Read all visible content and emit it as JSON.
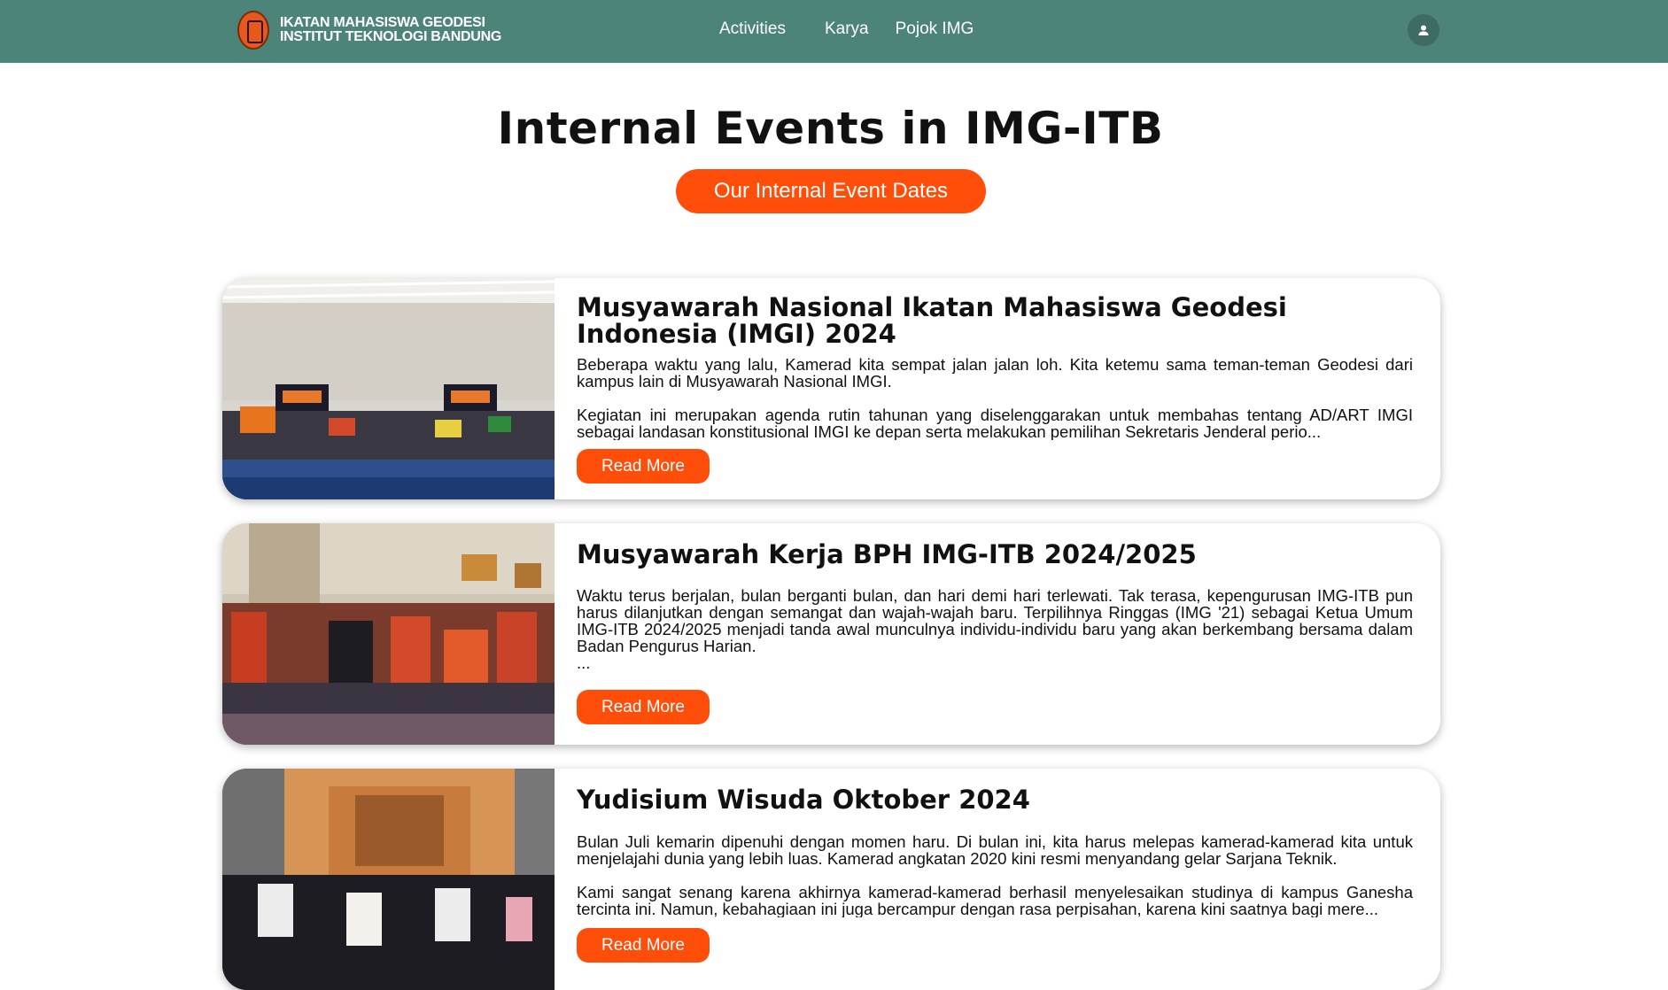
{
  "nav": {
    "brand_line1": "IKATAN MAHASISWA GEODESI",
    "brand_line2": "INSTITUT TEKNOLOGI BANDUNG",
    "links": [
      "Activities",
      "Karya",
      "Pojok IMG"
    ],
    "user_icon": "person-icon"
  },
  "header": {
    "title": "Internal Events in IMG-ITB",
    "dates_button": "Our Internal Event Dates"
  },
  "events": [
    {
      "title": "Musyawarah Nasional Ikatan Mahasiswa Geodesi Indonesia (IMGI) 2024",
      "p1": "Beberapa waktu yang lalu, Kamerad kita sempat jalan jalan loh. Kita ketemu sama teman-teman Geodesi dari kampus lain di Musyawarah Nasional IMGI.",
      "p2": "Kegiatan ini merupakan agenda rutin tahunan yang diselenggarakan untuk membahas tentang AD/ART IMGI sebagai landasan konstitusional IMGI ke depan serta melakukan pemilihan Sekretaris Jenderal perio...",
      "button": "Read More"
    },
    {
      "title": "Musyawarah Kerja BPH IMG-ITB 2024/2025",
      "p1": "Waktu terus berjalan, bulan berganti bulan, dan hari demi hari terlewati. Tak terasa, kepengurusan IMG-ITB pun harus dilanjutkan dengan semangat dan wajah-wajah baru. Terpilihnya Ringgas (IMG '21) sebagai Ketua Umum IMG-ITB 2024/2025 menjadi tanda awal munculnya individu-individu baru yang akan berkembang bersama dalam Badan Pengurus Harian.",
      "p2": "...",
      "button": "Read More"
    },
    {
      "title": "Yudisium Wisuda Oktober 2024",
      "p1": "Bulan Juli kemarin dipenuhi dengan momen haru. Di bulan ini, kita harus melepas kamerad-kamerad kita untuk menjelajahi dunia yang lebih luas. Kamerad angkatan 2020 kini resmi menyandang gelar Sarjana Teknik.",
      "p2": "Kami sangat senang karena akhirnya kamerad-kamerad berhasil menyelesaikan studinya di kampus Ganesha tercinta ini. Namun, kebahagiaan ini juga bercampur dengan rasa perpisahan, karena kini saatnya bagi mere...",
      "button": "Read More"
    }
  ]
}
